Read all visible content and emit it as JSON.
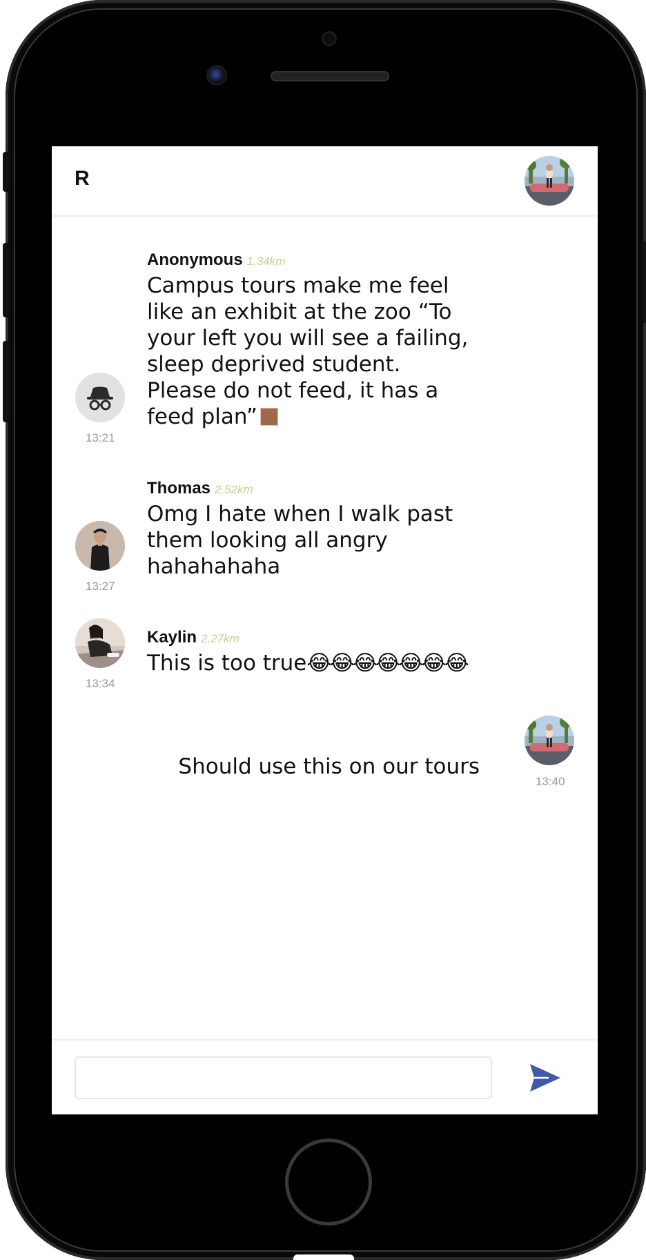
{
  "header": {
    "title": "R"
  },
  "messages": [
    {
      "author": "Anonymous",
      "distance": "1.34km",
      "text": "Campus tours make me feel like an exhibit at the zoo “To your left you will see a failing, sleep deprived student. Please do not feed, it has a feed plan”",
      "time": "13:21",
      "avatar": "incognito-icon"
    },
    {
      "author": "Thomas",
      "distance": "2.52km",
      "text": "Omg I hate when I walk past them looking all angry hahahahaha",
      "time": "13:27",
      "avatar": "thomas-avatar"
    },
    {
      "author": "Kaylin",
      "distance": "2.27km",
      "text": "This is too true",
      "emojis": "😂😂😂😂😂😂😂",
      "time": "13:34",
      "avatar": "kaylin-avatar"
    },
    {
      "text": "Should use this on our tours",
      "time": "13:40",
      "avatar": "self-avatar",
      "own": true
    }
  ],
  "composer": {
    "placeholder": "",
    "send_icon": "send-icon"
  },
  "colors": {
    "distance": "#c7d08d",
    "send": "#3f5aa8",
    "timestamp": "#9a9a9a"
  }
}
